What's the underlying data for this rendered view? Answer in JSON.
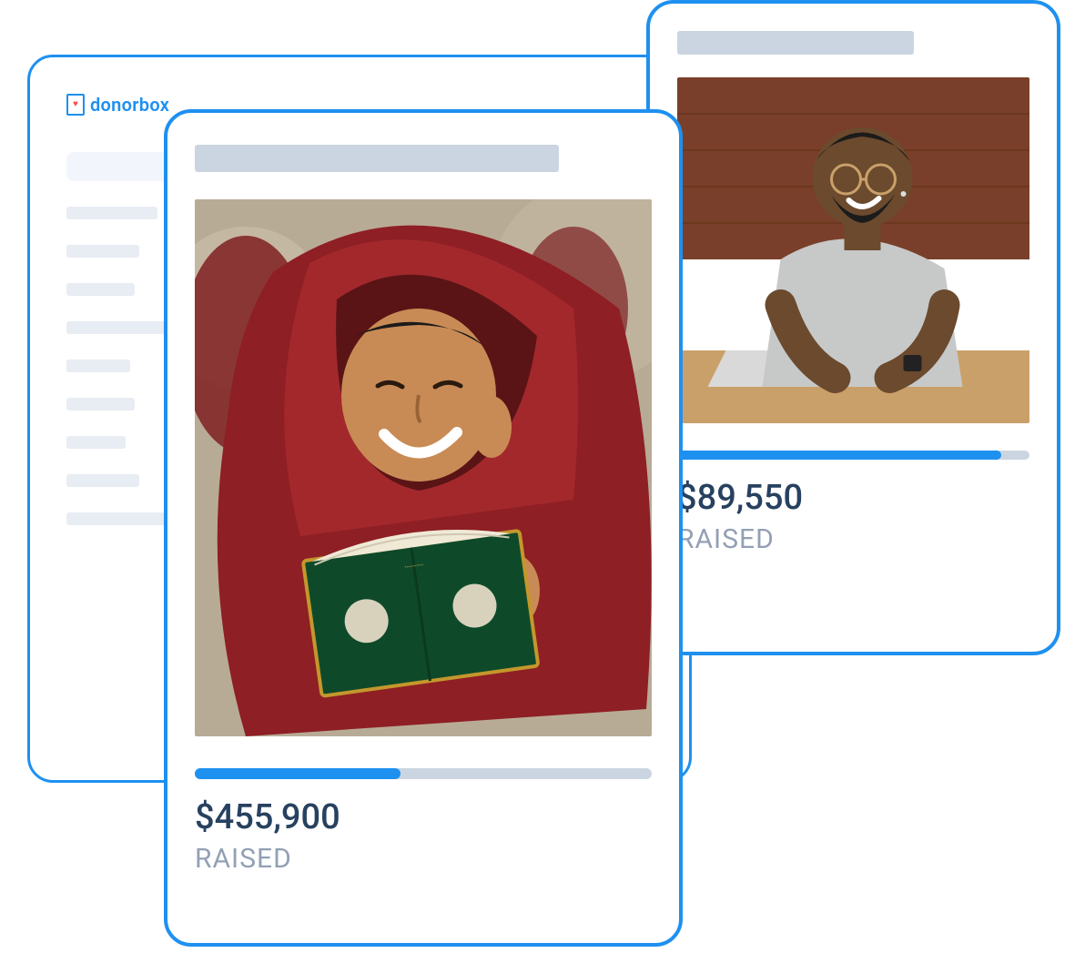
{
  "brand": {
    "name": "donorbox"
  },
  "cards": {
    "right": {
      "amount": "$89,550",
      "label": "RAISED",
      "progress_pct": 92
    },
    "front": {
      "amount": "$455,900",
      "label": "RAISED",
      "progress_pct": 45
    }
  }
}
